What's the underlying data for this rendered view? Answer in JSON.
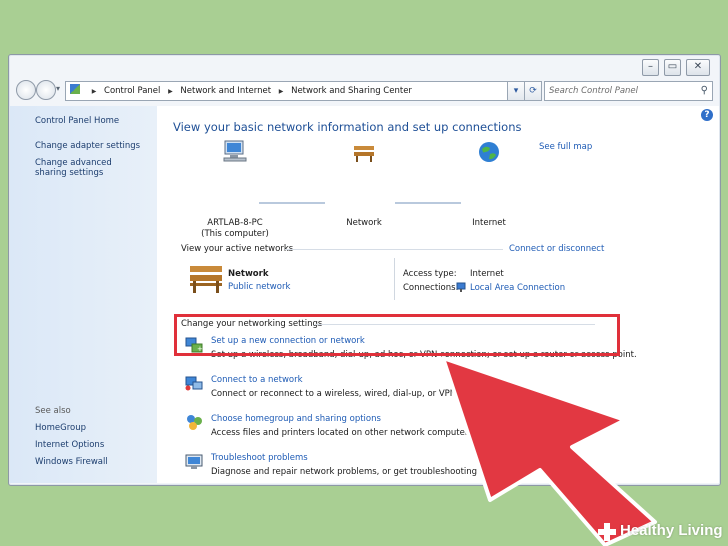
{
  "address": {
    "breadcrumbs": [
      "Control Panel",
      "Network and Internet",
      "Network and Sharing Center"
    ],
    "search_placeholder": "Search Control Panel"
  },
  "sidebar": {
    "home": "Control Panel Home",
    "links": [
      "Change adapter settings",
      "Change advanced sharing settings"
    ],
    "see_also_heading": "See also",
    "see_also": [
      "HomeGroup",
      "Internet Options",
      "Windows Firewall"
    ]
  },
  "main": {
    "title": "View your basic network information and set up connections",
    "see_full_map": "See full map",
    "map": {
      "computer_name": "ARTLAB-8-PC",
      "computer_sub": "(This computer)",
      "network": "Network",
      "internet": "Internet"
    },
    "active_networks_heading": "View your active networks",
    "connect_or_disconnect": "Connect or disconnect",
    "active_network": {
      "name": "Network",
      "type": "Public network",
      "access_type_label": "Access type:",
      "access_type_value": "Internet",
      "connections_label": "Connections:",
      "connections_value": "Local Area Connection"
    },
    "change_settings_heading": "Change your networking settings",
    "tasks": [
      {
        "title": "Set up a new connection or network",
        "desc": "Set up a wireless, broadband, dial-up, ad hoc, or VPN connection; or set up a router or access point."
      },
      {
        "title": "Connect to a network",
        "desc": "Connect or reconnect to a wireless, wired, dial-up, or VPN network connection."
      },
      {
        "title": "Choose homegroup and sharing options",
        "desc": "Access files and printers located on other network computers, or change sharing settings."
      },
      {
        "title": "Troubleshoot problems",
        "desc": "Diagnose and repair network problems, or get troubleshooting information."
      }
    ]
  },
  "watermark": "Healthy Living",
  "colors": {
    "background": "#a9cf93",
    "link": "#1e5bb5",
    "highlight": "#e0303a",
    "arrow": "#e23842"
  }
}
